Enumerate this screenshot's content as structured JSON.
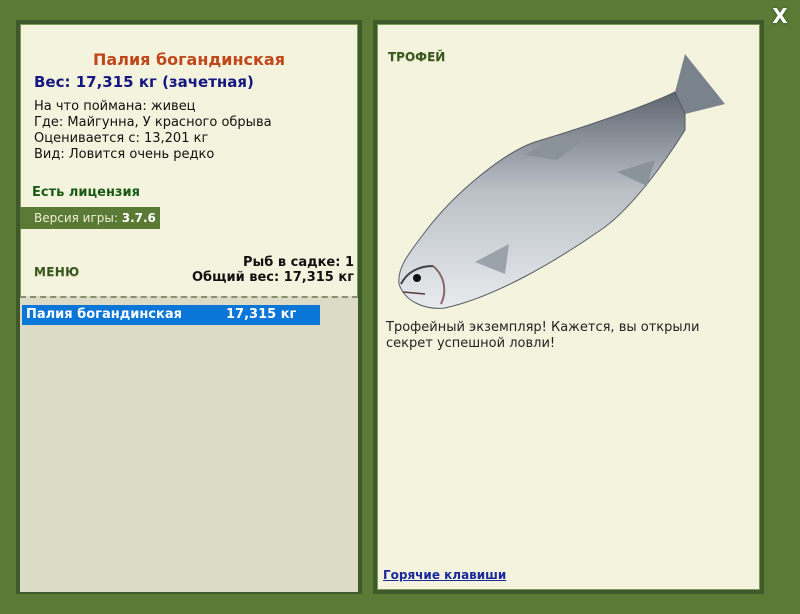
{
  "left": {
    "fish_name": "Палия богандинская",
    "weight_line": "Вес: 17,315 кг (зачетная)",
    "info": [
      "На что поймана: живец",
      "Где: Майгунна, У красного обрыва",
      "Оценивается с: 13,201 кг",
      "Вид: Ловится очень редко"
    ],
    "license": "Есть лицензия",
    "version_label": "Версия игры:",
    "version_value": "3.7.6",
    "menu_label": "МЕНЮ",
    "keep_count": "Рыб в садке: 1",
    "keep_total": "Общий вес: 17,315 кг",
    "catch_list": [
      {
        "name": "Палия богандинская",
        "weight": "17,315 кг"
      }
    ]
  },
  "right": {
    "trophy_label": "ТРОФЕЙ",
    "description": "Трофейный экземпляр! Кажется, вы открыли секрет успешной ловли!",
    "hotkeys": "Горячие клавиши"
  },
  "window": {
    "close_glyph": "X"
  },
  "icons": {
    "close": "close-icon"
  },
  "colors": {
    "frame": "#5a7a35",
    "panel": "#f4f3de",
    "title": "#c0471a",
    "weight": "#141880",
    "selection": "#0a77d8"
  }
}
